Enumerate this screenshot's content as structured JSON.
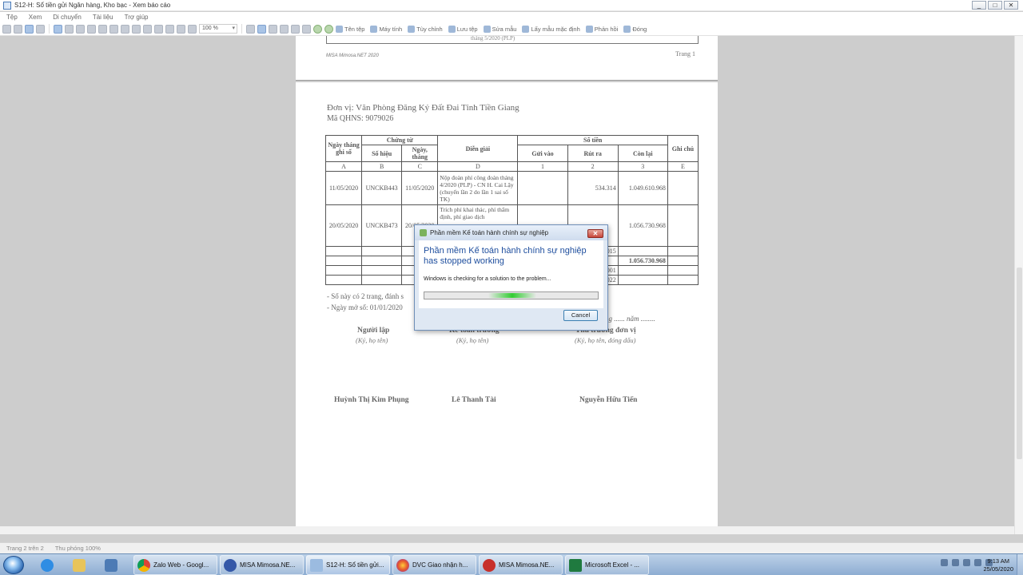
{
  "window": {
    "title": "S12-H: Sổ tiền gửi Ngân hàng, Kho bạc - Xem báo cáo",
    "controls": [
      "_",
      "□",
      "✕"
    ]
  },
  "menu": [
    "Tệp",
    "Xem",
    "Di chuyển",
    "Tài liệu",
    "Trợ giúp"
  ],
  "toolbar": {
    "zoom": "100 %",
    "buttons": [
      "Tên tệp",
      "Máy tính",
      "Tùy chỉnh",
      "Lưu tệp",
      "Sửa mẫu",
      "Lấy mẫu mặc định",
      "Phản hồi",
      "Đóng"
    ]
  },
  "page1": {
    "footer_left": "MISA Mimosa.NET 2020",
    "footer_right": "Trang 1",
    "cut_text": "tháng 5/2020 (PLP)"
  },
  "page2": {
    "unit": "Đơn vị: Văn Phòng Đăng Ký Đất Đai Tỉnh Tiền Giang",
    "qhns": "Mã QHNS: 9079026",
    "headers": {
      "ngay_ghi_so": "Ngày tháng ghi sổ",
      "chung_tu": "Chứng từ",
      "so_hieu": "Số hiệu",
      "ngay_thang": "Ngày, tháng",
      "dien_giai": "Diễn giải",
      "so_tien": "Số tiền",
      "gui_vao": "Gửi vào",
      "rut_ra": "Rút ra",
      "con_lai": "Còn lại",
      "ghi_chu": "Ghi chú"
    },
    "codes": [
      "A",
      "B",
      "C",
      "D",
      "1",
      "2",
      "3",
      "E"
    ],
    "rows": [
      {
        "date": "11/05/2020",
        "doc": "UNCKB443",
        "doc_date": "11/05/2020",
        "desc": "Nộp đoàn phí công đoàn tháng 4/2020 (PLP) - CN H. Cai Lậy (chuyển lần 2 do lần 1 sai số TK)",
        "in": "",
        "out": "534.314",
        "balance": "1.049.610.968"
      },
      {
        "date": "20/05/2020",
        "doc": "UNCKB473",
        "doc_date": "20/05/2020",
        "desc": "Trích phí khai thác, phí thẩm định, phí giao dịch",
        "in": "",
        "out": "",
        "balance": "1.056.730.968"
      }
    ],
    "extra": {
      "r1": "015",
      "r2_balance": "1.056.730.968",
      "r3": "001",
      "r4": "022"
    },
    "notes": [
      "- Sổ này có 2 trang, đánh s",
      "- Ngày mở sổ: 01/01/2020"
    ],
    "date_line": "ngày ...... tháng ...... năm ........",
    "signatures": [
      {
        "title": "Người lập",
        "sub": "(Ký, họ tên)",
        "name": "Huỳnh Thị Kim Phụng"
      },
      {
        "title": "Kế toán trưởng",
        "sub": "(Ký, họ tên)",
        "name": "Lê Thanh Tài"
      },
      {
        "title": "Thủ trưởng đơn vị",
        "sub": "(Ký, họ tên, đóng dấu)",
        "name": "Nguyễn Hữu Tiến"
      }
    ]
  },
  "dialog": {
    "title": "Phần mềm Kế toán hành chính sự nghiệp",
    "heading": "Phần mềm Kế toán hành chính sự nghiệp has stopped working",
    "message": "Windows is checking for a solution to the problem...",
    "cancel": "Cancel",
    "close": "✕"
  },
  "statusbar": {
    "page": "Trang 2 trên 2",
    "zoom": "Thu phóng 100%"
  },
  "taskbar": {
    "tasks": [
      "Zalo Web - Googl...",
      "MISA Mimosa.NE...",
      "S12-H: Sổ tiền gửi...",
      "DVC Giao nhận h...",
      "MISA Mimosa.NE...",
      "Microsoft Excel - ..."
    ],
    "time": "9:13 AM",
    "date": "25/05/2020"
  }
}
